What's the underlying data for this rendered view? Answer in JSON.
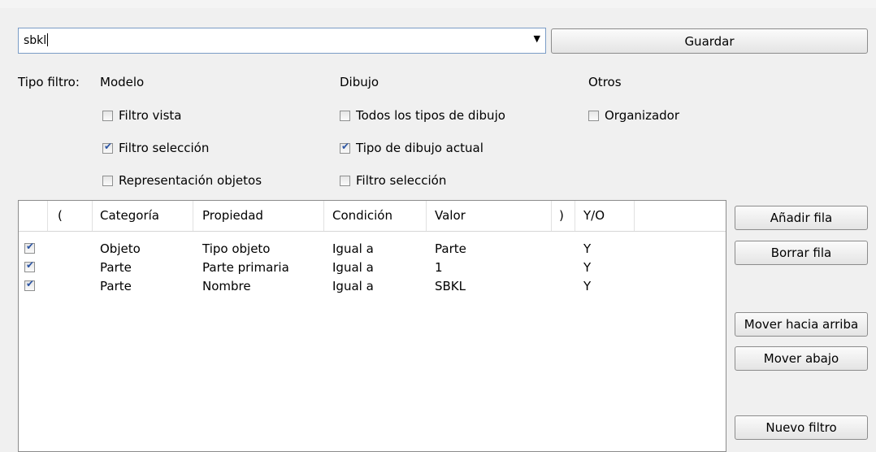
{
  "filter_combo": {
    "value": "sbkl"
  },
  "save_label": "Guardar",
  "filter_type": {
    "label": "Tipo filtro:",
    "groups": [
      {
        "title": "Modelo",
        "items": [
          {
            "label": "Filtro vista",
            "checked": false
          },
          {
            "label": "Filtro selección",
            "checked": true
          },
          {
            "label": "Representación objetos",
            "checked": false
          }
        ]
      },
      {
        "title": "Dibujo",
        "items": [
          {
            "label": "Todos los tipos de dibujo",
            "checked": false
          },
          {
            "label": "Tipo de dibujo actual",
            "checked": true
          },
          {
            "label": "Filtro selección",
            "checked": false
          }
        ]
      },
      {
        "title": "Otros",
        "items": [
          {
            "label": "Organizador",
            "checked": false
          }
        ]
      }
    ]
  },
  "grid": {
    "columns": [
      "(",
      "Categoría",
      "Propiedad",
      "Condición",
      "Valor",
      ")",
      "Y/O"
    ],
    "rows": [
      {
        "enabled": true,
        "open": "",
        "category": "Objeto",
        "property": "Tipo objeto",
        "condition": "Igual a",
        "value": "Parte",
        "close": "",
        "andor": "Y"
      },
      {
        "enabled": true,
        "open": "",
        "category": "Parte",
        "property": "Parte primaria",
        "condition": "Igual a",
        "value": "1",
        "close": "",
        "andor": "Y"
      },
      {
        "enabled": true,
        "open": "",
        "category": "Parte",
        "property": "Nombre",
        "condition": "Igual a",
        "value": "SBKL",
        "close": "",
        "andor": "Y"
      }
    ]
  },
  "side_buttons": {
    "add_row": "Añadir fila",
    "delete_row": "Borrar fila",
    "move_up": "Mover hacia arriba",
    "move_down": "Mover abajo",
    "new_filter": "Nuevo filtro"
  }
}
